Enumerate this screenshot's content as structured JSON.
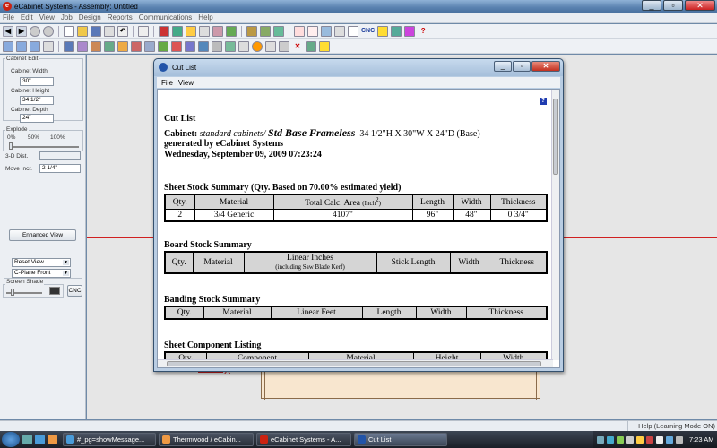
{
  "app": {
    "title": "eCabinet Systems - Assembly: Untitled",
    "logo_letter": "e"
  },
  "window_controls": {
    "minimize": "_",
    "maximize": "▫",
    "close": "✕"
  },
  "menu": [
    "File",
    "Edit",
    "View",
    "Job",
    "Design",
    "Reports",
    "Communications",
    "Help"
  ],
  "toolbar": {
    "cnc_label": "CNC"
  },
  "left_panel": {
    "group_title": "Cabinet Edit",
    "width_label": "Cabinet Width",
    "width_value": "30\"",
    "height_label": "Cabinet Height",
    "height_value": "34 1/2\"",
    "depth_label": "Cabinet Depth",
    "depth_value": "24\"",
    "explode_label": "Explode",
    "explode_0": "0%",
    "explode_50": "50%",
    "explode_100": "100%",
    "dist_label": "3-D Dist.",
    "move_label": "Move Incr.",
    "move_value": "2 1/4\"",
    "enhanced_view": "Enhanced View",
    "reset_view": "Reset View",
    "cplane": "C-Plane Front",
    "screen_shade": "Screen Shade",
    "cnc": "CNC"
  },
  "canvas": {
    "axis_label": "X"
  },
  "status": {
    "help": "Help (Learning Mode ON)"
  },
  "taskbar": {
    "tasks": [
      "#_pg=showMessage...",
      "Thermwood / eCabin...",
      "eCabinet Systems - A...",
      "Cut List"
    ],
    "clock": "7:23 AM"
  },
  "dialog": {
    "title": "Cut List",
    "menu": [
      "File",
      "View"
    ],
    "help_icon": "?",
    "report": {
      "heading": "Cut List",
      "cabinet_label": "Cabinet:",
      "cabinet_lib": "standard cabinets/",
      "cabinet_name": "Std Base Frameless",
      "cabinet_dims": "34 1/2\"H X 30\"W X 24\"D  (Base)",
      "generated_by": "generated by eCabinet Systems",
      "date": "Wednesday, September 09, 2009    07:23:24",
      "sheet_stock": {
        "title": "Sheet Stock Summary (Qty. Based on 70.00% estimated yield)",
        "headers": [
          "Qty.",
          "Material",
          "Total Calc. Area",
          "Length",
          "Width",
          "Thickness"
        ],
        "area_unit": "(Inch",
        "area_unit_sup": "2",
        "area_unit_close": ")",
        "row": [
          "2",
          "3/4 Generic",
          "4107\"",
          "96\"",
          "48\"",
          "0 3/4\""
        ]
      },
      "board_stock": {
        "title": "Board Stock Summary",
        "headers": [
          "Qty.",
          "Material",
          "Linear Inches",
          "Stick Length",
          "Width",
          "Thickness"
        ],
        "linear_sub": "(including Saw Blade Kerf)"
      },
      "banding_stock": {
        "title": "Banding Stock Summary",
        "headers": [
          "Qty.",
          "Material",
          "Linear Feet",
          "Length",
          "Width",
          "Thickness"
        ]
      },
      "sheet_component": {
        "title": "Sheet Component Listing",
        "headers": [
          "Qty.",
          "Component",
          "Material",
          "Height",
          "Width"
        ]
      }
    }
  }
}
